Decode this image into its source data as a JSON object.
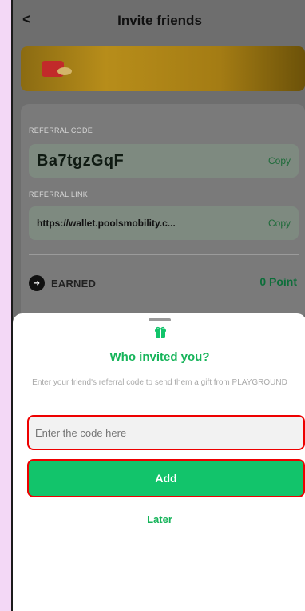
{
  "header": {
    "back_glyph": "<",
    "title": "Invite friends"
  },
  "referral": {
    "code_label": "REFERRAL CODE",
    "code_value": "Ba7tgzGqF",
    "code_copy": "Copy",
    "link_label": "REFERRAL LINK",
    "link_value": "https://wallet.poolsmobility.c...",
    "link_copy": "Copy"
  },
  "earned": {
    "label": "EARNED",
    "points": "0 Point"
  },
  "sheet": {
    "title": "Who invited you?",
    "description": "Enter your friend's referral code to send them a gift from PLAYGROUND",
    "input_placeholder": "Enter the code here",
    "add_label": "Add",
    "later_label": "Later"
  },
  "colors": {
    "accent_green": "#12c46b",
    "highlight_red": "#e00000"
  }
}
